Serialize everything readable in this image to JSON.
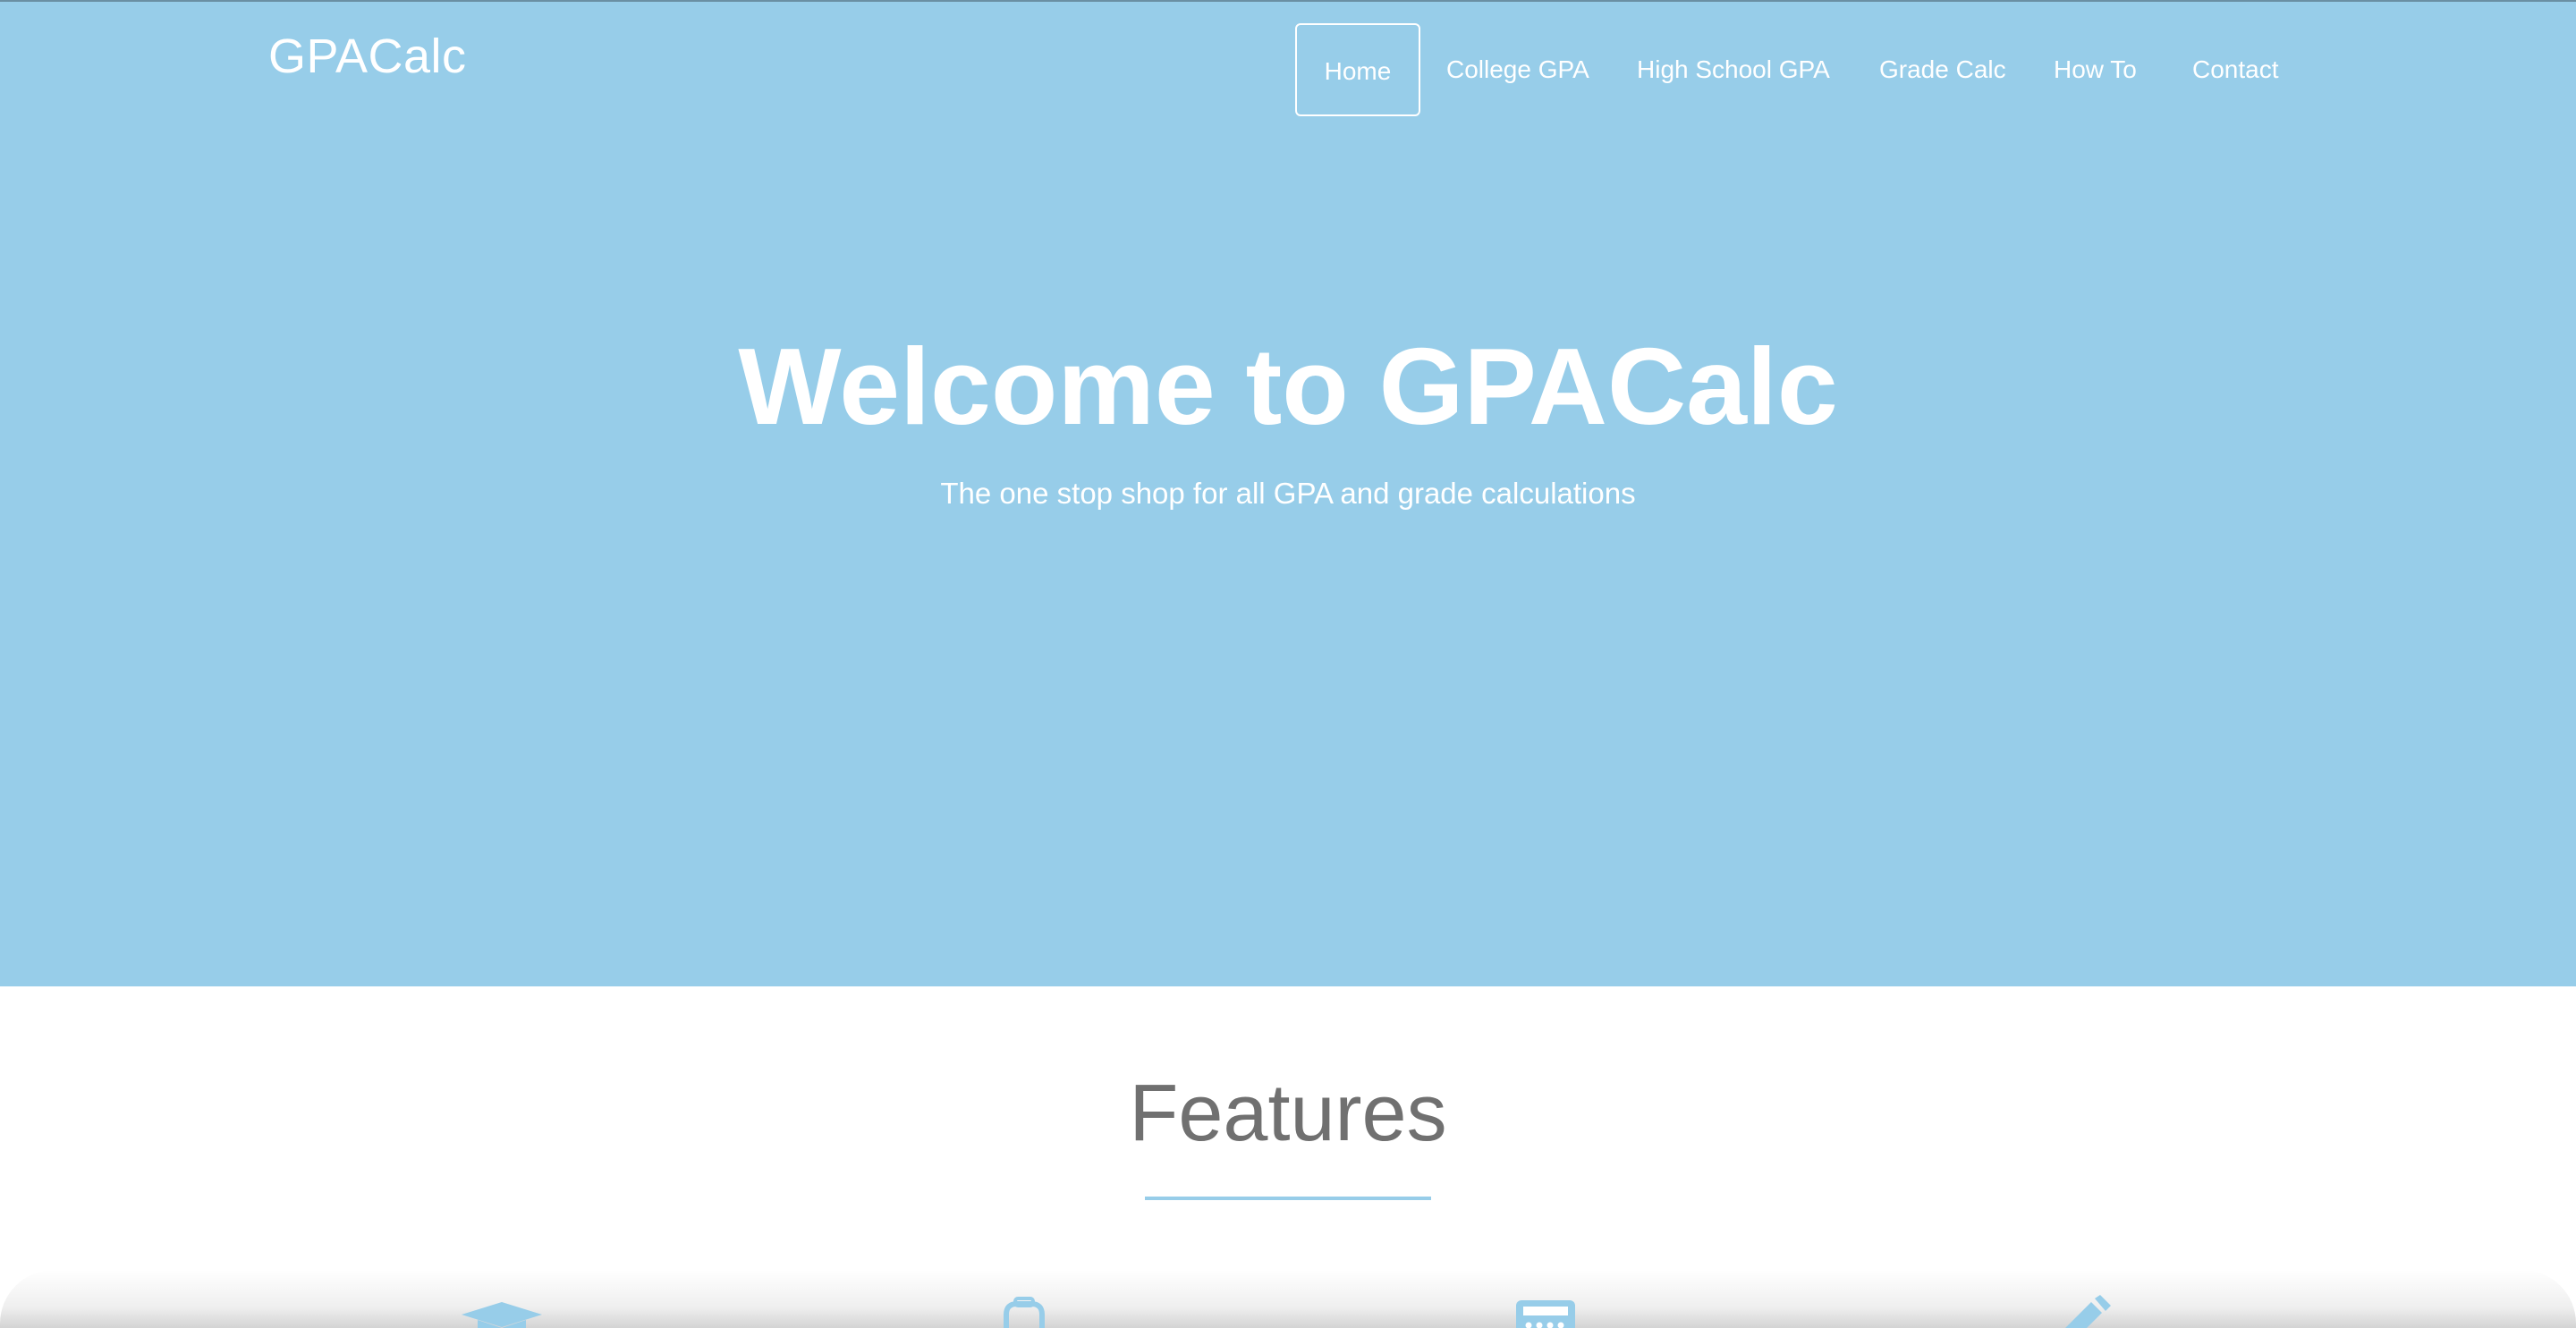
{
  "header": {
    "brand": "GPACalc"
  },
  "nav": {
    "items": [
      {
        "label": "Home",
        "active": true
      },
      {
        "label": "College GPA",
        "active": false
      },
      {
        "label": "High School GPA",
        "active": false
      },
      {
        "label": "Grade Calc",
        "active": false
      },
      {
        "label": "How To",
        "active": false
      },
      {
        "label": "Contact",
        "active": false
      }
    ]
  },
  "hero": {
    "title": "Welcome to GPACalc",
    "subtitle": "The one stop shop for all GPA and grade calculations",
    "background": "#97cde9"
  },
  "features": {
    "title": "Features",
    "accent": "#97cde9",
    "icons": [
      "graduation-cap-icon",
      "backpack-icon",
      "calculator-icon",
      "pencil-icon"
    ]
  }
}
